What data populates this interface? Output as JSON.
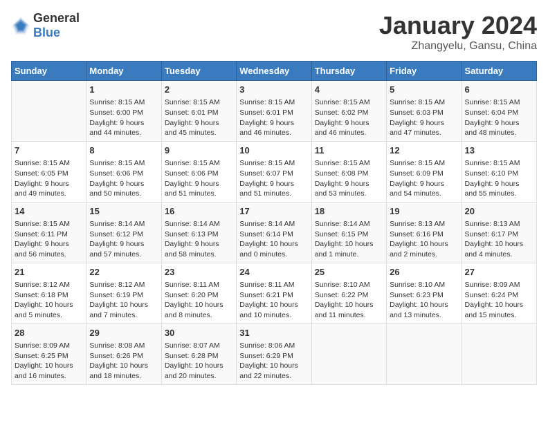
{
  "logo": {
    "general": "General",
    "blue": "Blue"
  },
  "title": "January 2024",
  "subtitle": "Zhangyelu, Gansu, China",
  "days_header": [
    "Sunday",
    "Monday",
    "Tuesday",
    "Wednesday",
    "Thursday",
    "Friday",
    "Saturday"
  ],
  "weeks": [
    [
      {
        "day": "",
        "info": ""
      },
      {
        "day": "1",
        "info": "Sunrise: 8:15 AM\nSunset: 6:00 PM\nDaylight: 9 hours\nand 44 minutes."
      },
      {
        "day": "2",
        "info": "Sunrise: 8:15 AM\nSunset: 6:01 PM\nDaylight: 9 hours\nand 45 minutes."
      },
      {
        "day": "3",
        "info": "Sunrise: 8:15 AM\nSunset: 6:01 PM\nDaylight: 9 hours\nand 46 minutes."
      },
      {
        "day": "4",
        "info": "Sunrise: 8:15 AM\nSunset: 6:02 PM\nDaylight: 9 hours\nand 46 minutes."
      },
      {
        "day": "5",
        "info": "Sunrise: 8:15 AM\nSunset: 6:03 PM\nDaylight: 9 hours\nand 47 minutes."
      },
      {
        "day": "6",
        "info": "Sunrise: 8:15 AM\nSunset: 6:04 PM\nDaylight: 9 hours\nand 48 minutes."
      }
    ],
    [
      {
        "day": "7",
        "info": "Sunrise: 8:15 AM\nSunset: 6:05 PM\nDaylight: 9 hours\nand 49 minutes."
      },
      {
        "day": "8",
        "info": "Sunrise: 8:15 AM\nSunset: 6:06 PM\nDaylight: 9 hours\nand 50 minutes."
      },
      {
        "day": "9",
        "info": "Sunrise: 8:15 AM\nSunset: 6:06 PM\nDaylight: 9 hours\nand 51 minutes."
      },
      {
        "day": "10",
        "info": "Sunrise: 8:15 AM\nSunset: 6:07 PM\nDaylight: 9 hours\nand 51 minutes."
      },
      {
        "day": "11",
        "info": "Sunrise: 8:15 AM\nSunset: 6:08 PM\nDaylight: 9 hours\nand 53 minutes."
      },
      {
        "day": "12",
        "info": "Sunrise: 8:15 AM\nSunset: 6:09 PM\nDaylight: 9 hours\nand 54 minutes."
      },
      {
        "day": "13",
        "info": "Sunrise: 8:15 AM\nSunset: 6:10 PM\nDaylight: 9 hours\nand 55 minutes."
      }
    ],
    [
      {
        "day": "14",
        "info": "Sunrise: 8:15 AM\nSunset: 6:11 PM\nDaylight: 9 hours\nand 56 minutes."
      },
      {
        "day": "15",
        "info": "Sunrise: 8:14 AM\nSunset: 6:12 PM\nDaylight: 9 hours\nand 57 minutes."
      },
      {
        "day": "16",
        "info": "Sunrise: 8:14 AM\nSunset: 6:13 PM\nDaylight: 9 hours\nand 58 minutes."
      },
      {
        "day": "17",
        "info": "Sunrise: 8:14 AM\nSunset: 6:14 PM\nDaylight: 10 hours\nand 0 minutes."
      },
      {
        "day": "18",
        "info": "Sunrise: 8:14 AM\nSunset: 6:15 PM\nDaylight: 10 hours\nand 1 minute."
      },
      {
        "day": "19",
        "info": "Sunrise: 8:13 AM\nSunset: 6:16 PM\nDaylight: 10 hours\nand 2 minutes."
      },
      {
        "day": "20",
        "info": "Sunrise: 8:13 AM\nSunset: 6:17 PM\nDaylight: 10 hours\nand 4 minutes."
      }
    ],
    [
      {
        "day": "21",
        "info": "Sunrise: 8:12 AM\nSunset: 6:18 PM\nDaylight: 10 hours\nand 5 minutes."
      },
      {
        "day": "22",
        "info": "Sunrise: 8:12 AM\nSunset: 6:19 PM\nDaylight: 10 hours\nand 7 minutes."
      },
      {
        "day": "23",
        "info": "Sunrise: 8:11 AM\nSunset: 6:20 PM\nDaylight: 10 hours\nand 8 minutes."
      },
      {
        "day": "24",
        "info": "Sunrise: 8:11 AM\nSunset: 6:21 PM\nDaylight: 10 hours\nand 10 minutes."
      },
      {
        "day": "25",
        "info": "Sunrise: 8:10 AM\nSunset: 6:22 PM\nDaylight: 10 hours\nand 11 minutes."
      },
      {
        "day": "26",
        "info": "Sunrise: 8:10 AM\nSunset: 6:23 PM\nDaylight: 10 hours\nand 13 minutes."
      },
      {
        "day": "27",
        "info": "Sunrise: 8:09 AM\nSunset: 6:24 PM\nDaylight: 10 hours\nand 15 minutes."
      }
    ],
    [
      {
        "day": "28",
        "info": "Sunrise: 8:09 AM\nSunset: 6:25 PM\nDaylight: 10 hours\nand 16 minutes."
      },
      {
        "day": "29",
        "info": "Sunrise: 8:08 AM\nSunset: 6:26 PM\nDaylight: 10 hours\nand 18 minutes."
      },
      {
        "day": "30",
        "info": "Sunrise: 8:07 AM\nSunset: 6:28 PM\nDaylight: 10 hours\nand 20 minutes."
      },
      {
        "day": "31",
        "info": "Sunrise: 8:06 AM\nSunset: 6:29 PM\nDaylight: 10 hours\nand 22 minutes."
      },
      {
        "day": "",
        "info": ""
      },
      {
        "day": "",
        "info": ""
      },
      {
        "day": "",
        "info": ""
      }
    ]
  ]
}
